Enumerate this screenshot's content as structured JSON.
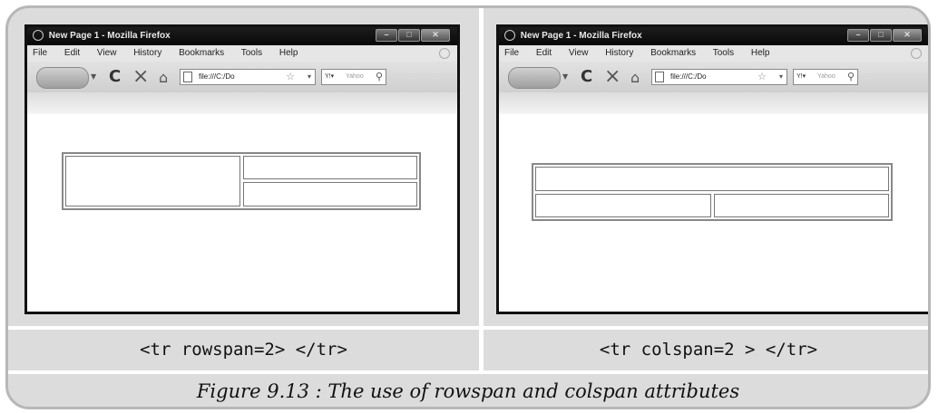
{
  "panels": [
    {
      "window": {
        "title": "New Page 1 - Mozilla Firefox",
        "menu": [
          "File",
          "Edit",
          "View",
          "History",
          "Bookmarks",
          "Tools",
          "Help"
        ],
        "url": "file:///C:/Do",
        "search_placeholder": "Yahoo"
      },
      "caption": "<tr rowspan=2> </tr>"
    },
    {
      "window": {
        "title": "New Page 1 - Mozilla Firefox",
        "menu": [
          "File",
          "Edit",
          "View",
          "History",
          "Bookmarks",
          "Tools",
          "Help"
        ],
        "url": "file:///C:/Do",
        "search_placeholder": "Yahoo"
      },
      "caption": "<tr colspan=2 > </tr>"
    }
  ],
  "figure_caption": "Figure 9.13 : The use of rowspan and colspan attributes",
  "icons": [
    "firefox-icon",
    "minimize-icon",
    "maximize-icon",
    "close-icon",
    "gear-icon",
    "back-icon",
    "forward-icon",
    "reload-icon",
    "stop-icon",
    "home-icon",
    "page-icon",
    "star-icon",
    "search-icon"
  ]
}
